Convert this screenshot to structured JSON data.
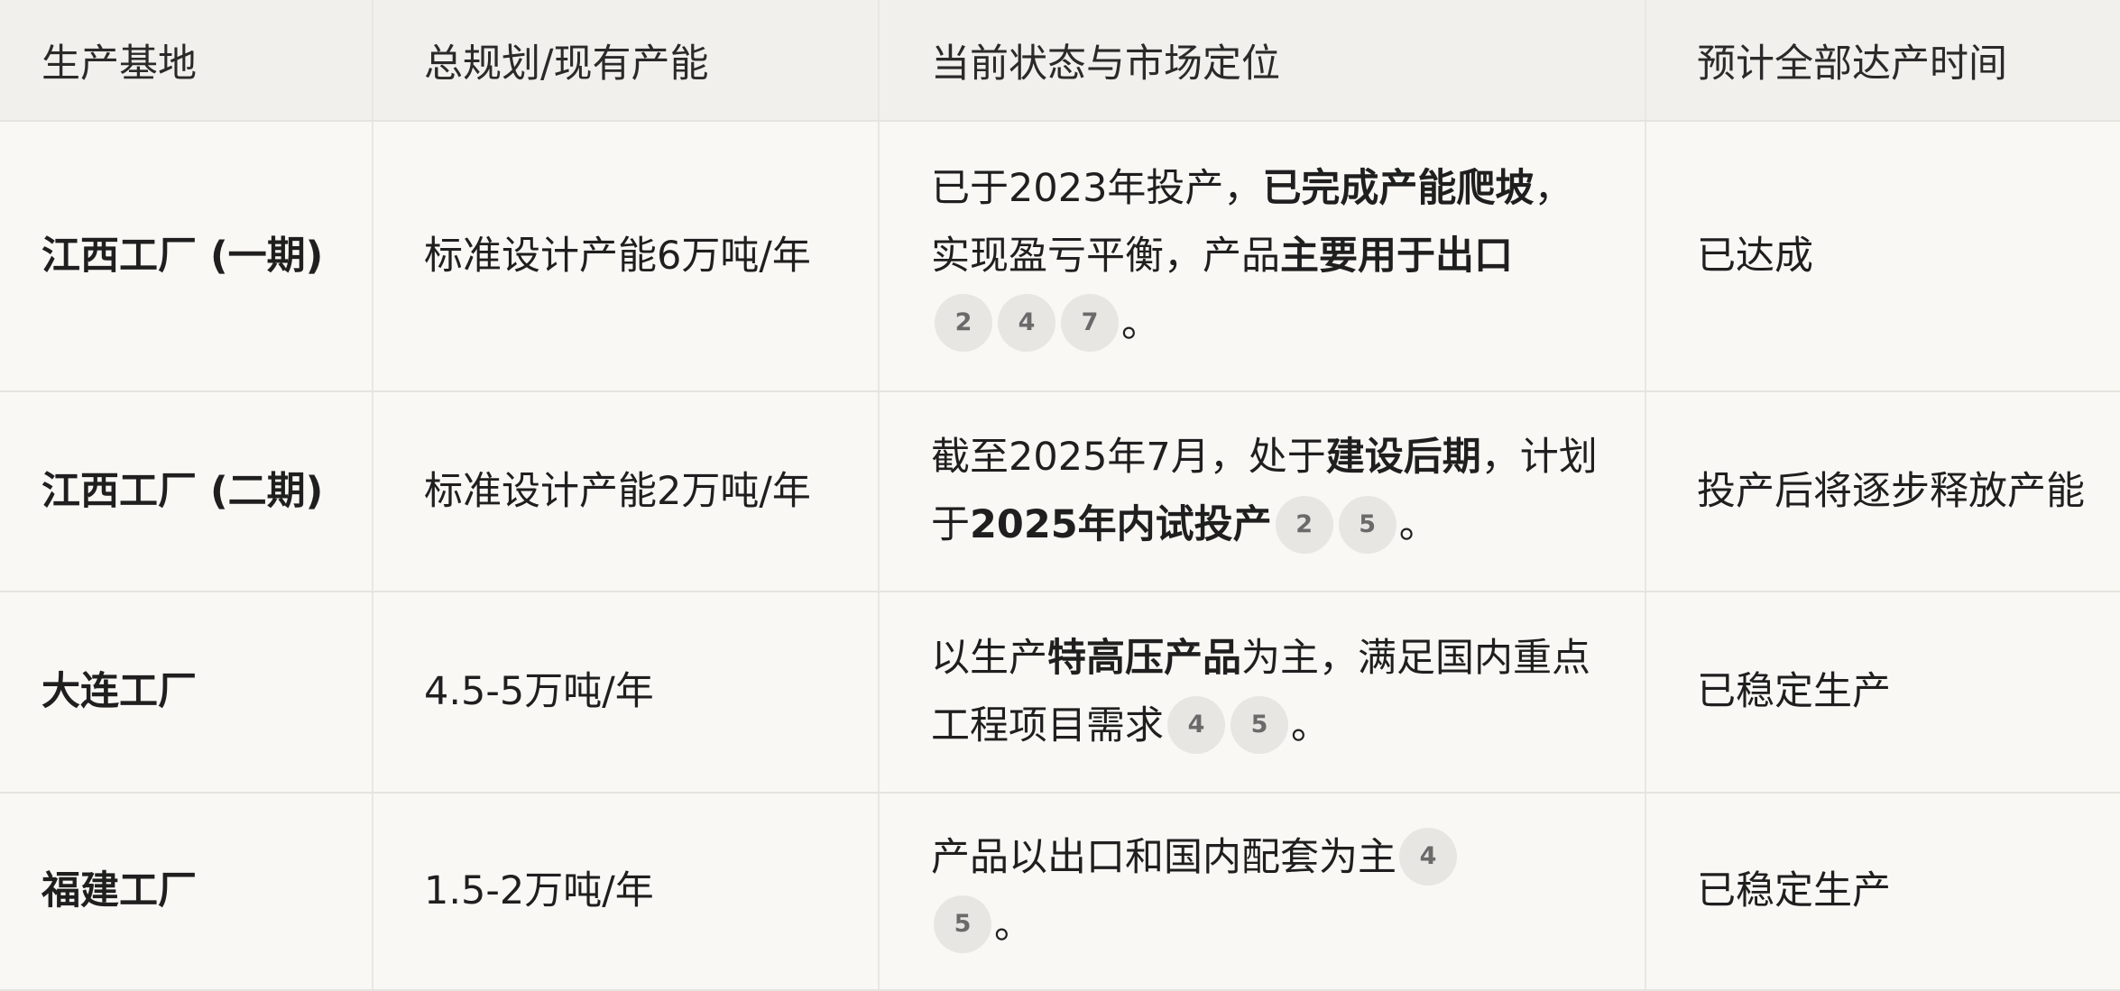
{
  "table": {
    "headers": [
      "生产基地",
      "总规划/现有产能",
      "当前状态与市场定位",
      "预计全部达产时间"
    ],
    "rows": [
      {
        "base": "江西工厂 (一期)",
        "capacity": "标准设计产能6万吨/年",
        "status": {
          "t1": "已于2023年投产，",
          "b1": "已完成产能爬坡",
          "t2": "，实现盈亏平衡，产品",
          "b2": "主要用于出口",
          "citations": [
            "2",
            "4",
            "7"
          ],
          "end": "。"
        },
        "time": "已达成"
      },
      {
        "base": "江西工厂 (二期)",
        "capacity": "标准设计产能2万吨/年",
        "status": {
          "t1": "截至2025年7月，处于",
          "b1": "建设后期",
          "t2": "，计划于",
          "b2": "2025年内试投产",
          "citations": [
            "2",
            "5"
          ],
          "end": "。"
        },
        "time": "投产后将逐步释放产能"
      },
      {
        "base": "大连工厂",
        "capacity": "4.5-5万吨/年",
        "status": {
          "t1": "以生产",
          "b1": "特高压产品",
          "t2": "为主，满足国内重点工程项目需求",
          "citations": [
            "4",
            "5"
          ],
          "end": "。"
        },
        "time": "已稳定生产"
      },
      {
        "base": "福建工厂",
        "capacity": "1.5-2万吨/年",
        "status": {
          "t1": "产品以出口和国内配套为主",
          "citations": [
            "4",
            "5"
          ],
          "end": "。"
        },
        "time": "已稳定生产"
      }
    ]
  }
}
